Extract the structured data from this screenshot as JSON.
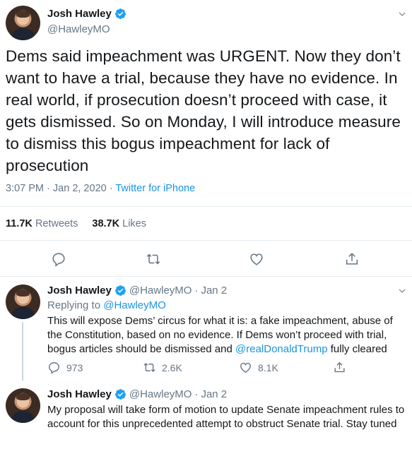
{
  "main_tweet": {
    "author_name": "Josh Hawley",
    "author_handle": "@HawleyMO",
    "text": "Dems said impeachment was URGENT. Now they don’t want to have a trial, because they have no evidence. In real world, if prosecution doesn’t proceed with case, it gets dismissed. So on Monday, I will introduce measure to dismiss this bogus impeachment for lack of prosecution",
    "time": "3:07 PM",
    "date": "Jan 2, 2020",
    "separator": "·",
    "source": "Twitter for iPhone",
    "retweets_count": "11.7K",
    "retweets_label": "Retweets",
    "likes_count": "38.7K",
    "likes_label": "Likes",
    "icons": {
      "reply": "reply-icon",
      "retweet": "retweet-icon",
      "like": "heart-icon",
      "share": "share-icon",
      "more": "chevron-down-icon",
      "verified": "verified-badge-icon"
    }
  },
  "replies": [
    {
      "author_name": "Josh Hawley",
      "author_handle": "@HawleyMO",
      "separator": "·",
      "date": "Jan 2",
      "replying_prefix": "Replying to",
      "replying_to": "@HawleyMO",
      "text_before_mention": "This will expose Dems’ circus for what it is: a fake impeachment, abuse of the Constitution, based on no evidence. If Dems won’t proceed with trial, bogus articles should be dismissed and ",
      "mention": "@realDonaldTrump",
      "text_after_mention": " fully cleared",
      "reply_count": "973",
      "retweet_count": "2.6K",
      "like_count": "8.1K"
    },
    {
      "author_name": "Josh Hawley",
      "author_handle": "@HawleyMO",
      "separator": "·",
      "date": "Jan 2",
      "text": "My proposal will take form of motion to update Senate impeachment rules to account for this unprecedented attempt to obstruct Senate trial. Stay tuned"
    }
  ],
  "colors": {
    "link": "#1b95e0",
    "muted": "#657786",
    "text": "#14171a",
    "divider": "#e6ecf0"
  }
}
